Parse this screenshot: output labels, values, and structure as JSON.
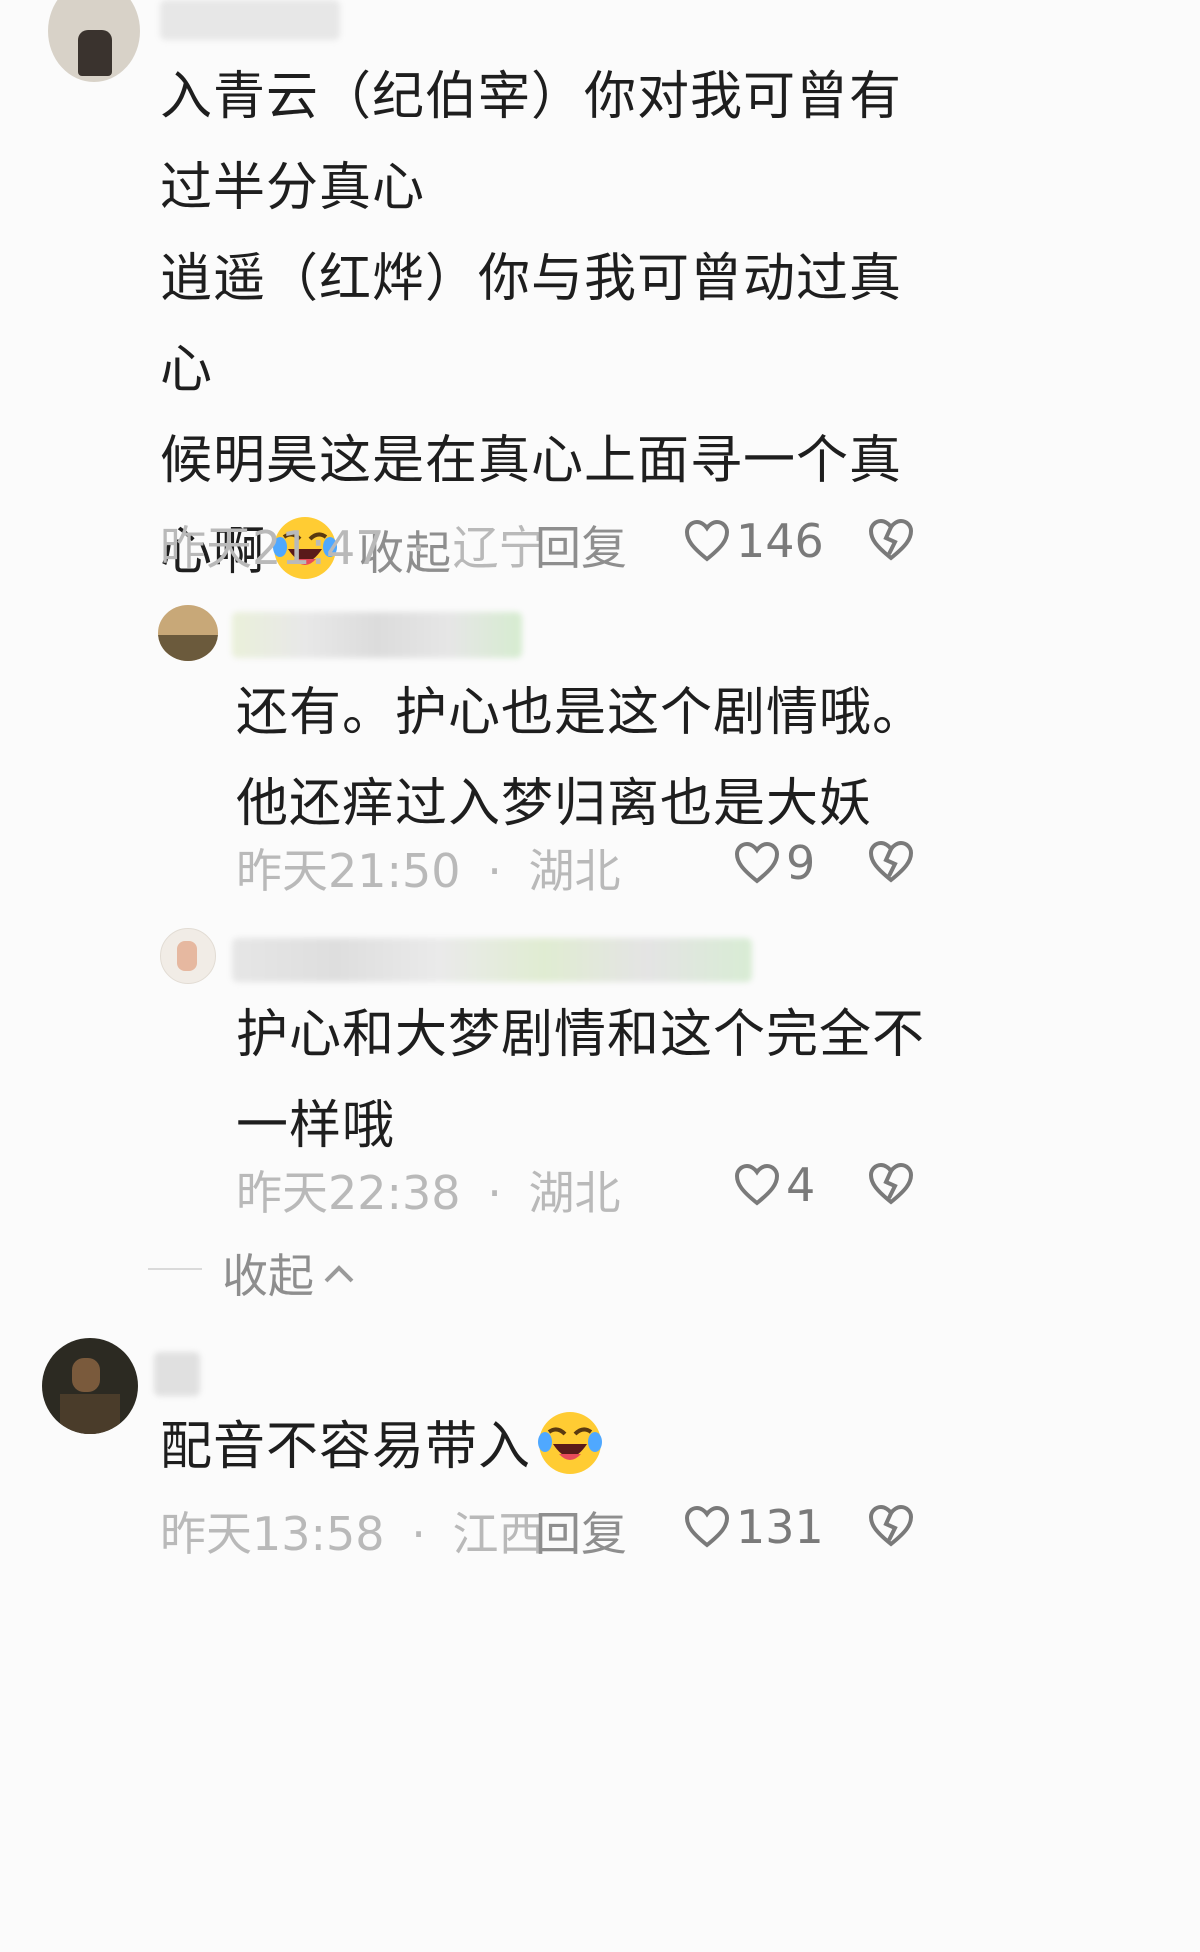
{
  "comments": [
    {
      "text_lines": [
        "入青云（纪伯宰）你对我可曾有",
        "过半分真心",
        "逍遥（红烨）你与我可曾动过真",
        "心",
        "候明昊这是在真心上面寻一个真"
      ],
      "last_line": "心啊",
      "emoji": "grinning-squinting-tears-emoji",
      "collapse_label": "收起",
      "time": "昨天21:47",
      "location": "辽宁",
      "reply_label": "回复",
      "likes": "146"
    },
    {
      "text_lines": [
        "还有。护心也是这个剧情哦。",
        "他还痒过入梦归离也是大妖"
      ],
      "time": "昨天21:50",
      "location": "湖北",
      "likes": "9"
    },
    {
      "text_lines": [
        "护心和大梦剧情和这个完全不",
        "一样哦"
      ],
      "time": "昨天22:38",
      "location": "湖北",
      "likes": "4"
    },
    {
      "text": "配音不容易带入",
      "emoji": "grinning-squinting-tears-emoji",
      "time": "昨天13:58",
      "location": "江西",
      "reply_label": "回复",
      "likes": "131"
    }
  ],
  "thread_collapse": {
    "label": "收起"
  },
  "meta_separator": "·",
  "colors": {
    "background": "#fbfbfb",
    "text": "#1e1e1e",
    "meta": "#b9b9b9",
    "action": "#8e8e8e"
  }
}
